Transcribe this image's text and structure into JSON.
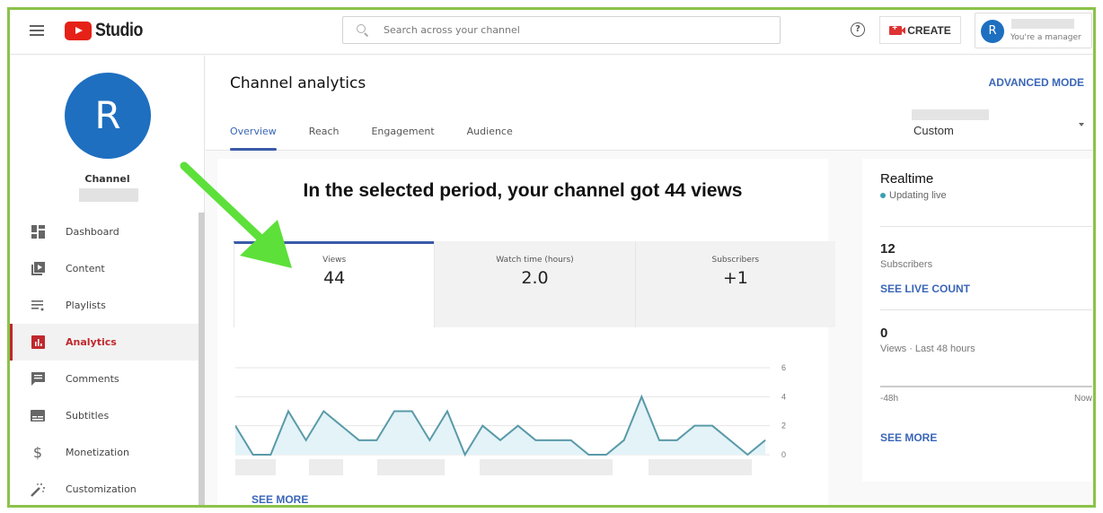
{
  "header": {
    "app_name": "Studio",
    "search_placeholder": "Search across your channel",
    "create_label": "CREATE",
    "account_initial": "R",
    "account_role": "You're a manager"
  },
  "sidebar": {
    "channel_initial": "R",
    "channel_label": "Channel",
    "items": [
      {
        "label": "Dashboard",
        "icon": "dashboard-icon",
        "active": false
      },
      {
        "label": "Content",
        "icon": "content-icon",
        "active": false
      },
      {
        "label": "Playlists",
        "icon": "playlists-icon",
        "active": false
      },
      {
        "label": "Analytics",
        "icon": "analytics-icon",
        "active": true
      },
      {
        "label": "Comments",
        "icon": "comments-icon",
        "active": false
      },
      {
        "label": "Subtitles",
        "icon": "subtitles-icon",
        "active": false
      },
      {
        "label": "Monetization",
        "icon": "dollar-icon",
        "active": false
      },
      {
        "label": "Customization",
        "icon": "magic-wand-icon",
        "active": false
      }
    ]
  },
  "main": {
    "title": "Channel analytics",
    "advanced_mode": "ADVANCED MODE",
    "tabs": [
      "Overview",
      "Reach",
      "Engagement",
      "Audience"
    ],
    "active_tab": "Overview",
    "date_selector": "Custom",
    "summary": "In the selected period, your channel got 44 views",
    "metrics": [
      {
        "label": "Views",
        "value": "44"
      },
      {
        "label": "Watch time (hours)",
        "value": "2.0"
      },
      {
        "label": "Subscribers",
        "value": "+1"
      }
    ],
    "see_more": "SEE MORE"
  },
  "realtime": {
    "title": "Realtime",
    "status": "Updating live",
    "subscribers_value": "12",
    "subscribers_label": "Subscribers",
    "see_live_count": "SEE LIVE COUNT",
    "views_value": "0",
    "views_label": "Views · Last 48 hours",
    "axis_start": "-48h",
    "axis_end": "Now",
    "see_more": "SEE MORE"
  },
  "colors": {
    "accent_blue": "#3a66b8",
    "youtube_red": "#e62117",
    "chart_line": "#5a9aa8",
    "chart_fill": "#e3f3f8",
    "annotation_arrow": "#5de03a",
    "frame_border": "#8bc34a"
  },
  "chart_data": {
    "type": "area",
    "title": "Views",
    "xlabel": "",
    "ylabel": "",
    "x_labels_hidden": true,
    "ylim": [
      0,
      6
    ],
    "yticks": [
      0,
      2,
      4,
      6
    ],
    "grid": true,
    "series": [
      {
        "name": "Views",
        "values": [
          2,
          0,
          0,
          3,
          1,
          3,
          2,
          1,
          1,
          3,
          3,
          1,
          3,
          0,
          2,
          1,
          2,
          1,
          1,
          1,
          0,
          0,
          1,
          4,
          1,
          1,
          2,
          2,
          1,
          0,
          1
        ]
      }
    ]
  }
}
